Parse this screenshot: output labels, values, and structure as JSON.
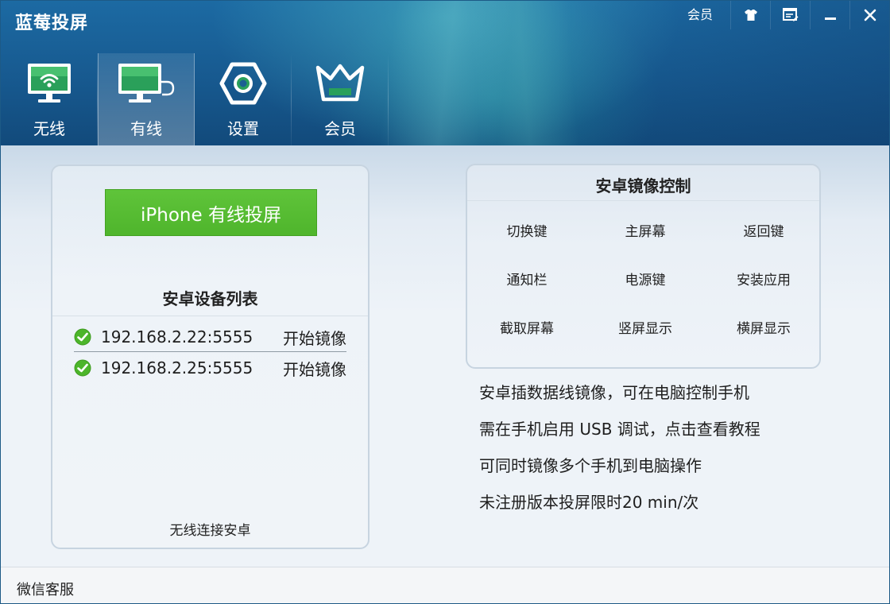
{
  "window": {
    "title": "蓝莓投屏",
    "member_label": "会员"
  },
  "icons": {
    "skin": "shirt-icon",
    "feedback": "edit-window-icon",
    "minimize": "minimize-icon",
    "close": "close-icon"
  },
  "nav": {
    "tabs": [
      {
        "label": "无线",
        "icon": "wifi-monitor-icon",
        "active": false
      },
      {
        "label": "有线",
        "icon": "wired-monitor-icon",
        "active": true
      },
      {
        "label": "设置",
        "icon": "hexagon-gear-icon",
        "active": false
      },
      {
        "label": "会员",
        "icon": "crown-icon",
        "active": false
      }
    ]
  },
  "left_panel": {
    "iphone_button": "iPhone 有线投屏",
    "list_title": "安卓设备列表",
    "devices": [
      {
        "ip": "192.168.2.22:5555",
        "action": "开始镜像"
      },
      {
        "ip": "192.168.2.25:5555",
        "action": "开始镜像"
      }
    ],
    "wireless_link": "无线连接安卓"
  },
  "right_panel": {
    "title": "安卓镜像控制",
    "controls": [
      "切换键",
      "主屏幕",
      "返回键",
      "通知栏",
      "电源键",
      "安装应用",
      "截取屏幕",
      "竖屏显示",
      "横屏显示"
    ]
  },
  "info": {
    "lines": [
      "安卓插数据线镜像，可在电脑控制手机",
      "需在手机启用 USB 调试，点击查看教程",
      "可同时镜像多个手机到电脑操作",
      "未注册版本投屏限时20 min/次"
    ]
  },
  "footer": {
    "wechat_service": "微信客服"
  },
  "colors": {
    "header_blue": "#17598f",
    "button_green": "#52b82f",
    "check_green": "#4cb52a"
  }
}
